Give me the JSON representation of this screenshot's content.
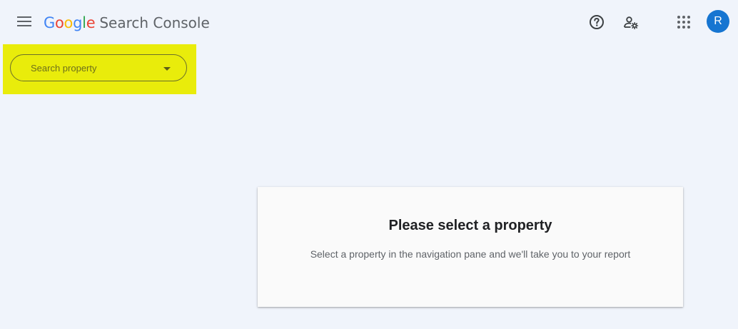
{
  "header": {
    "logo_letters": [
      "G",
      "o",
      "o",
      "g",
      "l",
      "e"
    ],
    "logo_colors": [
      "#4285f4",
      "#ea4335",
      "#fbbc05",
      "#4285f4",
      "#34a853",
      "#ea4335"
    ],
    "product_name": "Search Console",
    "avatar_initial": "R",
    "icons": [
      "menu-icon",
      "help-icon",
      "manage-users-icon",
      "apps-grid-icon"
    ]
  },
  "sidebar": {
    "search_property_placeholder": "Search property",
    "highlight_color": "#e9ec0b"
  },
  "main": {
    "card_title": "Please select a property",
    "card_subtitle": "Select a property in the navigation pane and we'll take you to your report"
  }
}
